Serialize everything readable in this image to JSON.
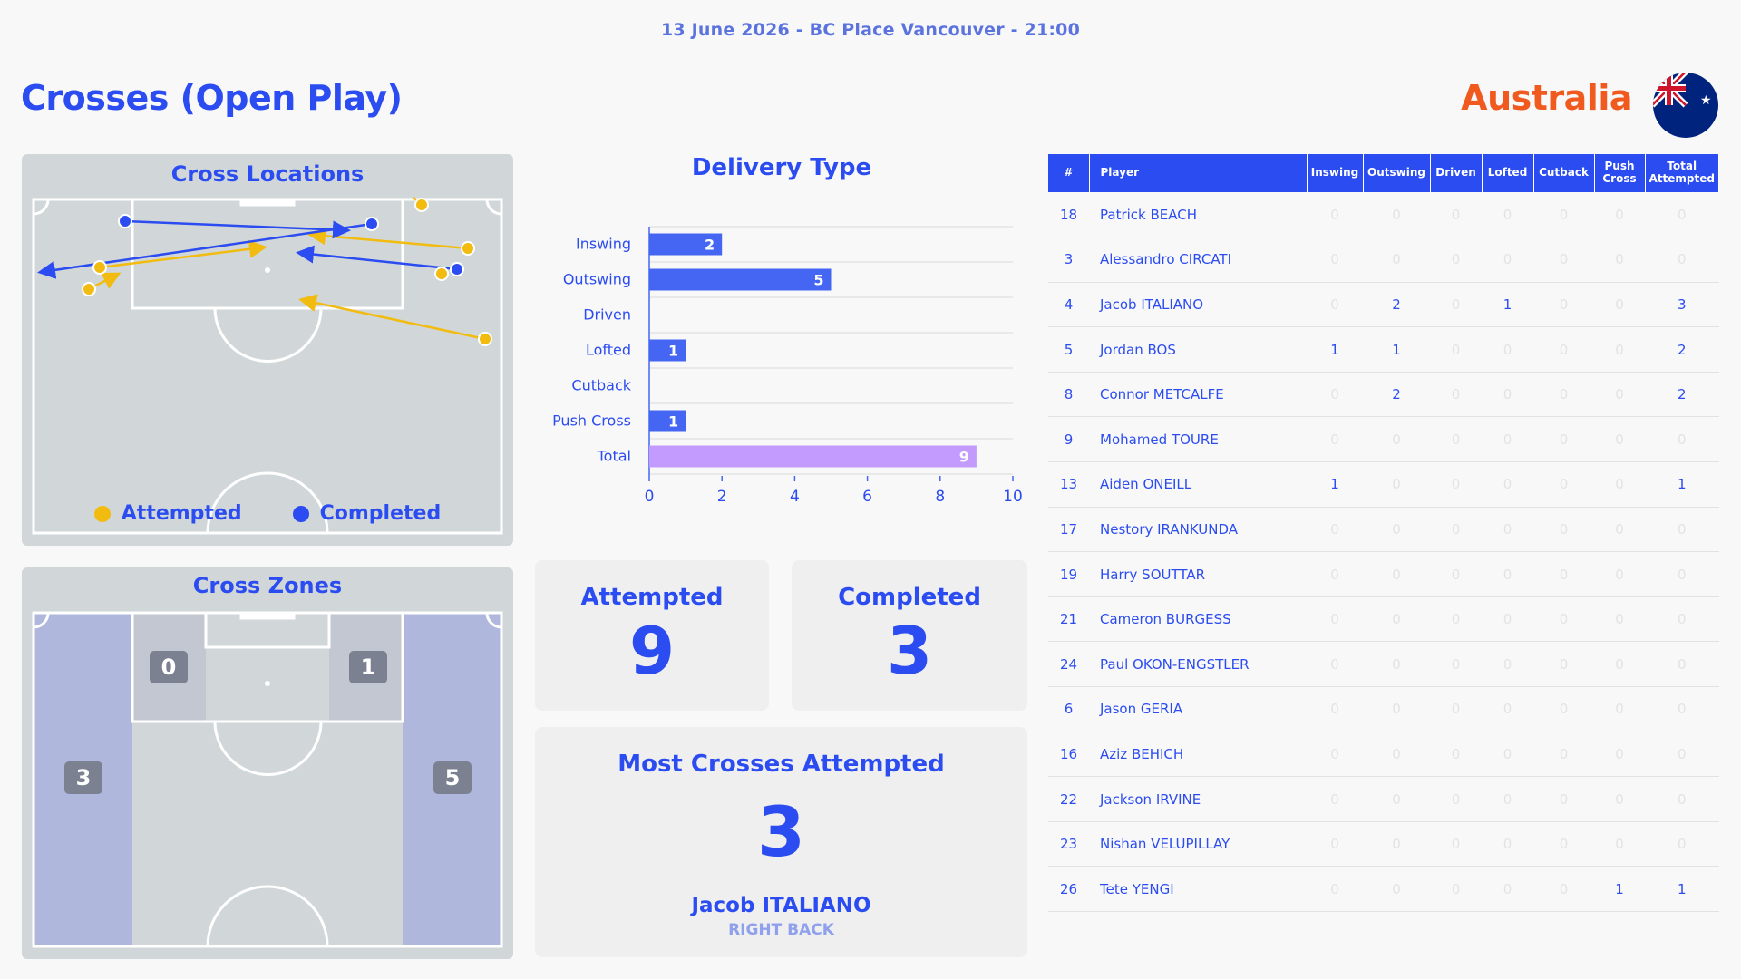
{
  "header": {
    "match_info": "13 June 2026 - BC Place Vancouver - 21:00",
    "title": "Crosses (Open Play)",
    "team": "Australia",
    "flag_icon": "australia-flag-icon"
  },
  "colors": {
    "primary": "#2b4cf0",
    "accent_orange": "#f05a1e",
    "attempted": "#f2bb0f",
    "completed": "#2b4cf0",
    "total_bar": "#c39bff",
    "pitch": "#d1d7d8",
    "zone_wide": "#afb8dc",
    "zone_half_space": "#c3c7d1"
  },
  "cross_locations": {
    "title": "Cross Locations",
    "legend": {
      "attempted": "Attempted",
      "completed": "Completed"
    }
  },
  "cross_zones": {
    "title": "Cross Zones",
    "zones": {
      "left_half_space": "0",
      "right_half_space": "1",
      "left_wide": "3",
      "right_wide": "5"
    }
  },
  "chart_data": {
    "type": "bar",
    "orientation": "horizontal",
    "title": "Delivery Type",
    "categories": [
      "Inswing",
      "Outswing",
      "Driven",
      "Lofted",
      "Cutback",
      "Push Cross",
      "Total"
    ],
    "values": [
      2,
      5,
      0,
      1,
      0,
      1,
      9
    ],
    "xlim": [
      0,
      10
    ],
    "xticks": [
      0,
      2,
      4,
      6,
      8,
      10
    ],
    "grid": true,
    "colors": [
      "#4466f2",
      "#4466f2",
      "#4466f2",
      "#4466f2",
      "#4466f2",
      "#4466f2",
      "#c39bff"
    ]
  },
  "stats": {
    "attempted_label": "Attempted",
    "attempted_value": "9",
    "completed_label": "Completed",
    "completed_value": "3",
    "most_label": "Most Crosses Attempted",
    "most_value": "3",
    "most_player": "Jacob ITALIANO",
    "most_position": "RIGHT BACK"
  },
  "table": {
    "headers": [
      "#",
      "Player",
      "Inswing",
      "Outswing",
      "Driven",
      "Lofted",
      "Cutback",
      "Push Cross",
      "Total Attempted"
    ],
    "rows": [
      {
        "num": "18",
        "player": "Patrick BEACH",
        "vals": [
          "0",
          "0",
          "0",
          "0",
          "0",
          "0",
          "0"
        ]
      },
      {
        "num": "3",
        "player": "Alessandro CIRCATI",
        "vals": [
          "0",
          "0",
          "0",
          "0",
          "0",
          "0",
          "0"
        ]
      },
      {
        "num": "4",
        "player": "Jacob ITALIANO",
        "vals": [
          "0",
          "2",
          "0",
          "1",
          "0",
          "0",
          "3"
        ]
      },
      {
        "num": "5",
        "player": "Jordan BOS",
        "vals": [
          "1",
          "1",
          "0",
          "0",
          "0",
          "0",
          "2"
        ]
      },
      {
        "num": "8",
        "player": "Connor METCALFE",
        "vals": [
          "0",
          "2",
          "0",
          "0",
          "0",
          "0",
          "2"
        ]
      },
      {
        "num": "9",
        "player": "Mohamed TOURE",
        "vals": [
          "0",
          "0",
          "0",
          "0",
          "0",
          "0",
          "0"
        ]
      },
      {
        "num": "13",
        "player": "Aiden ONEILL",
        "vals": [
          "1",
          "0",
          "0",
          "0",
          "0",
          "0",
          "1"
        ]
      },
      {
        "num": "17",
        "player": "Nestory IRANKUNDA",
        "vals": [
          "0",
          "0",
          "0",
          "0",
          "0",
          "0",
          "0"
        ]
      },
      {
        "num": "19",
        "player": "Harry SOUTTAR",
        "vals": [
          "0",
          "0",
          "0",
          "0",
          "0",
          "0",
          "0"
        ]
      },
      {
        "num": "21",
        "player": "Cameron BURGESS",
        "vals": [
          "0",
          "0",
          "0",
          "0",
          "0",
          "0",
          "0"
        ]
      },
      {
        "num": "24",
        "player": "Paul OKON-ENGSTLER",
        "vals": [
          "0",
          "0",
          "0",
          "0",
          "0",
          "0",
          "0"
        ]
      },
      {
        "num": "6",
        "player": "Jason GERIA",
        "vals": [
          "0",
          "0",
          "0",
          "0",
          "0",
          "0",
          "0"
        ]
      },
      {
        "num": "16",
        "player": "Aziz BEHICH",
        "vals": [
          "0",
          "0",
          "0",
          "0",
          "0",
          "0",
          "0"
        ]
      },
      {
        "num": "22",
        "player": "Jackson IRVINE",
        "vals": [
          "0",
          "0",
          "0",
          "0",
          "0",
          "0",
          "0"
        ]
      },
      {
        "num": "23",
        "player": "Nishan VELUPILLAY",
        "vals": [
          "0",
          "0",
          "0",
          "0",
          "0",
          "0",
          "0"
        ]
      },
      {
        "num": "26",
        "player": "Tete YENGI",
        "vals": [
          "0",
          "0",
          "0",
          "0",
          "0",
          "1",
          "1"
        ]
      }
    ]
  }
}
